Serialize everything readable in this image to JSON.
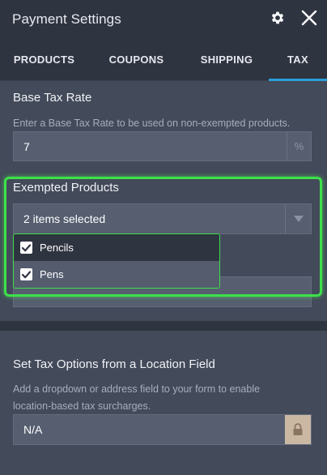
{
  "header": {
    "title": "Payment Settings",
    "settings_icon": "gear-icon",
    "close_icon": "close-icon"
  },
  "tabs": [
    {
      "label": "PRODUCTS",
      "active": false
    },
    {
      "label": "COUPONS",
      "active": false
    },
    {
      "label": "SHIPPING",
      "active": false
    },
    {
      "label": "TAX",
      "active": true
    }
  ],
  "base_tax": {
    "title": "Base Tax Rate",
    "help": "Enter a Base Tax Rate to be used on non-exempted products.",
    "value": "7",
    "suffix": "%"
  },
  "exempted": {
    "title": "Exempted Products",
    "selected_text": "2 items selected",
    "options": [
      {
        "label": "Pencils",
        "checked": true
      },
      {
        "label": "Pens",
        "checked": true
      }
    ]
  },
  "location": {
    "title": "Set Tax Options from a Location Field",
    "help_line1": "Add a dropdown or address field to your form to enable",
    "help_line2": "location-based tax surcharges.",
    "value": "N/A",
    "lock_icon": "lock-icon"
  },
  "colors": {
    "accent": "#2a9fd8",
    "highlight": "#3ee04a",
    "background": "#2f3441",
    "panel": "#434a5a"
  }
}
